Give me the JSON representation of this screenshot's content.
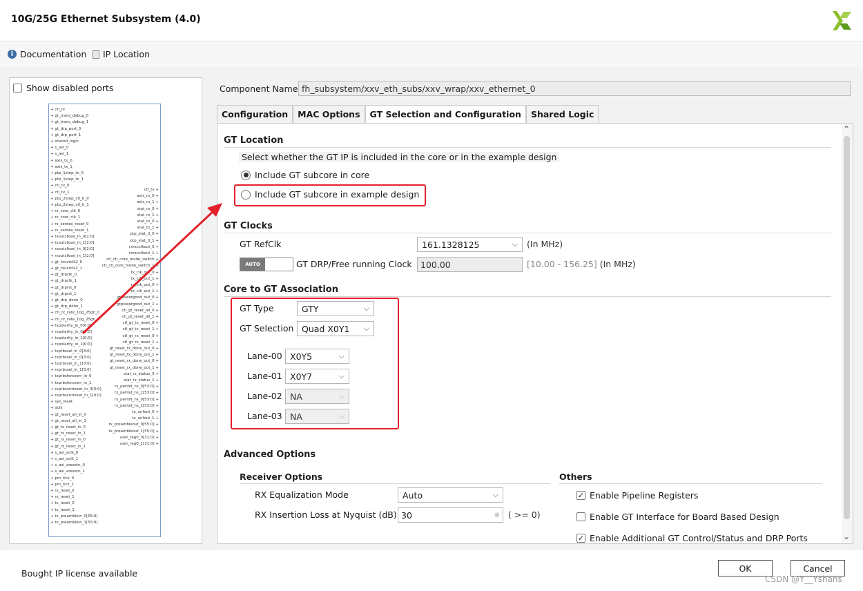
{
  "window": {
    "title": "10G/25G Ethernet Subsystem (4.0)"
  },
  "toolbar": {
    "documentation": "Documentation",
    "ip_location": "IP Location"
  },
  "left_panel": {
    "show_disabled_ports": "Show disabled ports",
    "ports_left": [
      "ctl_rx",
      "gt_trans_debug_0",
      "gt_trans_debug_1",
      "gt_drp_port_0",
      "gt_drp_port_1",
      "shared_logic",
      "s_axi_0",
      "s_axi_1",
      "axis_tx_0",
      "axis_tx_1",
      "ptp_1step_tx_0",
      "ptp_1step_tx_1",
      "ctl_tx_0",
      "ctl_tx_1",
      "ptp_2step_ctl_tl_0",
      "ptp_2step_ctl_tl_1",
      "rx_core_clk_0",
      "rx_core_clk_1",
      "rx_serdes_reset_0",
      "rx_serdes_reset_1",
      "txoutclksel_in_0[2:0]",
      "txoutclksel_in_1[2:0]",
      "rxoutclksel_in_0[2:0]",
      "rxoutclksel_in_1[2:0]",
      "gt_txusrclk2_0",
      "gt_txusrclk2_1",
      "gt_drpclk_0",
      "gt_drpclk_1",
      "gt_drprst_0",
      "gt_drprst_1",
      "gt_drp_done_0",
      "gt_drp_done_1",
      "ctl_rx_rate_10g_25gn_0",
      "ctl_rx_rate_10g_25gn_1",
      "txpolarity_in_0[0:0]",
      "rxpolarity_in_0[0:0]",
      "txpolarity_in_1[0:0]",
      "rxpolarity_in_1[0:0]",
      "txprbssel_in_0[3:0]",
      "rxprbssel_in_0[3:0]",
      "txprbssel_in_1[3:0]",
      "rxprbssel_in_1[3:0]",
      "txprbsforceerr_in_0",
      "txprbsforceerr_in_1",
      "rxprbscntreset_in_0[0:0]",
      "rxprbscntreset_in_1[0:0]",
      "sys_reset",
      "dclk",
      "gt_reset_all_in_0",
      "gt_reset_all_in_1",
      "gt_tx_reset_in_0",
      "gt_tx_reset_in_1",
      "gt_rx_reset_in_0",
      "gt_rx_reset_in_1",
      "s_axi_aclk_0",
      "s_axi_aclk_1",
      "s_axi_aresetn_0",
      "s_axi_aresetn_1",
      "pm_tick_0",
      "pm_tick_1",
      "rx_reset_0",
      "rx_reset_1",
      "tx_reset_0",
      "tx_reset_1",
      "tx_preamblein_0[55:0]",
      "tx_preamblein_1[55:0]"
    ],
    "ports_right": [
      "ctl_tx",
      "axis_rx_0",
      "axis_rx_1",
      "stat_rx_0",
      "stat_rx_1",
      "stat_tx_0",
      "stat_tx_1",
      "ptp_stat_tl_0",
      "ptp_stat_tl_1",
      "rxrecclkout_0",
      "rxrecclkout_1",
      "ctl_ctl_core_mode_switch",
      "ctl_ctl_core_mode_switch_1",
      "tx_clk_out_0",
      "tx_clk_out_1",
      "rx_clk_out_0",
      "rx_clk_out_1",
      "gtpowergood_out_0",
      "gtpowergood_out_1",
      "ctl_gt_reset_all_0",
      "ctl_gt_reset_all_1",
      "ctl_gt_tx_reset_0",
      "ctl_gt_tx_reset_1",
      "ctl_gt_rx_reset_0",
      "ctl_gt_rx_reset_1",
      "gt_reset_tx_done_out_0",
      "gt_reset_tx_done_out_1",
      "gt_reset_rx_done_out_0",
      "gt_reset_rx_done_out_1",
      "stat_rx_status_0",
      "stat_rx_status_1",
      "tx_period_ns_0[53:0]",
      "tx_period_ns_1[53:0]",
      "rx_period_ns_0[53:0]",
      "rx_period_ns_1[53:0]",
      "tx_unfout_0",
      "tx_unfout_1",
      "rx_preambleout_0[55:0]",
      "rx_preambleout_1[55:0]",
      "user_reg0_0[31:0]",
      "user_reg0_1[31:0]"
    ]
  },
  "component": {
    "label": "Component Name",
    "value": "fh_subsystem/xxv_eth_subs/xxv_wrap/xxv_ethernet_0"
  },
  "tabs": [
    "Configuration",
    "MAC Options",
    "GT Selection and Configuration",
    "Shared Logic"
  ],
  "gt_location": {
    "title": "GT Location",
    "description": "Select whether the GT IP is included in the core or in the example design",
    "option_core": "Include GT subcore in core",
    "option_example": "Include GT subcore in example design"
  },
  "gt_clocks": {
    "title": "GT Clocks",
    "refclk_label": "GT RefClk",
    "refclk_value": "161.1328125",
    "refclk_unit": "(In MHz)",
    "auto_label": "AUTO",
    "drp_label": "GT DRP/Free running Clock",
    "drp_value": "100.00",
    "drp_range": "[10.00 - 156.25]",
    "drp_unit": "(In MHz)"
  },
  "core_gt": {
    "title": "Core to GT Association",
    "gt_type_label": "GT Type",
    "gt_type_value": "GTY",
    "gt_sel_label": "GT Selection",
    "gt_sel_value": "Quad X0Y1",
    "lanes": [
      {
        "label": "Lane-00",
        "value": "X0Y5"
      },
      {
        "label": "Lane-01",
        "value": "X0Y7"
      },
      {
        "label": "Lane-02",
        "value": "NA"
      },
      {
        "label": "Lane-03",
        "value": "NA"
      }
    ]
  },
  "advanced": {
    "title": "Advanced Options",
    "receiver_title": "Receiver Options",
    "rx_eq_label": "RX Equalization Mode",
    "rx_eq_value": "Auto",
    "rx_loss_label": "RX Insertion Loss at Nyquist (dB)",
    "rx_loss_value": "30",
    "rx_loss_hint": "( >= 0)",
    "others_title": "Others",
    "others": [
      {
        "label": "Enable Pipeline Registers",
        "checked": true
      },
      {
        "label": "Enable GT Interface for Board Based Design",
        "checked": false
      },
      {
        "label": "Enable Additional GT Control/Status and DRP Ports",
        "checked": true
      }
    ]
  },
  "footer": {
    "license": "Bought IP license available",
    "ok": "OK",
    "cancel": "Cancel",
    "watermark": "CSDN @Y__Yshans"
  },
  "colors": {
    "highlight": "#e2202a",
    "logo": "#8bbf2e"
  }
}
